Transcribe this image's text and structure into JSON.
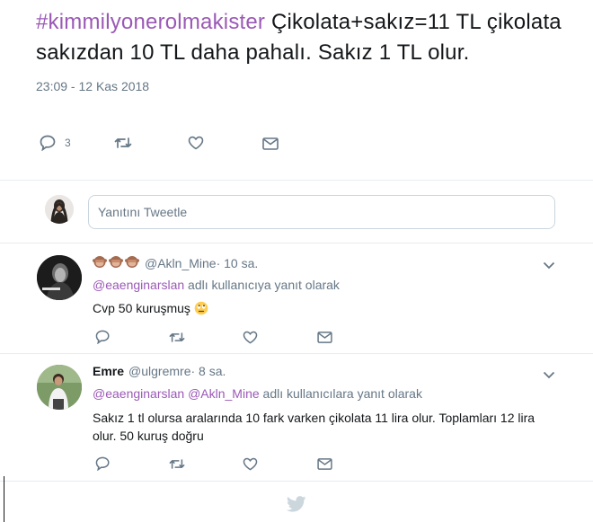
{
  "main_tweet": {
    "hashtag": "#kimmilyonerolmakister",
    "text": " Çikolata+sakız=11 TL çikolata sakızdan 10 TL daha pahalı. Sakız 1 TL olur.",
    "timestamp": "23:09 - 12 Kas 2018",
    "reply_count": "3"
  },
  "reply_box": {
    "placeholder": "Yanıtını Tweetle"
  },
  "replies": [
    {
      "emoji_icons": [
        "see-no-evil-monkey-icon",
        "see-no-evil-monkey-icon",
        "see-no-evil-monkey-icon"
      ],
      "handle": "@Akln_Mine",
      "time": " · 10 sa.",
      "replying_mentions": [
        "@eaenginarslan"
      ],
      "replying_suffix": " adlı kullanıcıya yanıt olarak",
      "text": "Cvp 50 kuruşmuş "
    },
    {
      "name": "Emre",
      "handle": "@ulgremre",
      "time": " · 8 sa.",
      "replying_mentions": [
        "@eaenginarslan",
        "@Akln_Mine"
      ],
      "replying_suffix": " adlı kullanıcılara yanıt olarak",
      "text": "Sakız 1 tl olursa aralarında 10 fark varken çikolata 11 lira olur. Toplamları 12 lira olur. 50 kuruş doğru"
    }
  ],
  "colors": {
    "accent": "#9b59b6",
    "muted": "#657786",
    "divider": "#e6ecf0",
    "twitter_bird": "#ccd6dd"
  }
}
